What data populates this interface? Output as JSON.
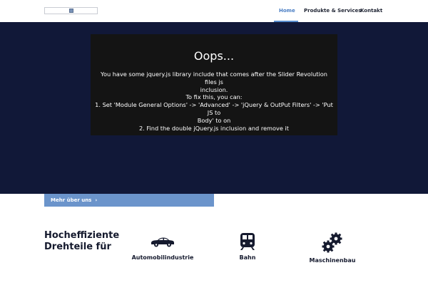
{
  "nav": {
    "items": [
      {
        "label": "Home"
      },
      {
        "label": "Produkte & Services"
      },
      {
        "label": "Kontakt"
      }
    ]
  },
  "hero": {
    "error": {
      "title": "Oops...",
      "lines": [
        "You have some jquery.js library include that comes after the Slider Revolution files js",
        "inclusion.",
        "To fix this, you can:",
        "1. Set 'Module General Options' -> 'Advanced' -> 'jQuery & OutPut Filters' -> 'Put JS to",
        "Body' to on",
        "2. Find the double jQuery.js inclusion and remove it"
      ]
    }
  },
  "cta": {
    "label": "Mehr über uns",
    "arrow": "›"
  },
  "section": {
    "heading_lines": [
      "Hocheffiziente",
      "Drehteile für"
    ]
  },
  "features": [
    {
      "label": "Automobilindustrie",
      "icon": "car-icon"
    },
    {
      "label": "Bahn",
      "icon": "train-icon"
    },
    {
      "label": "Maschinenbau",
      "icon": "gears-icon"
    }
  ],
  "colors": {
    "hero_bg": "#111838",
    "accent": "#6b94cb",
    "nav_active": "#4a7ec4"
  }
}
